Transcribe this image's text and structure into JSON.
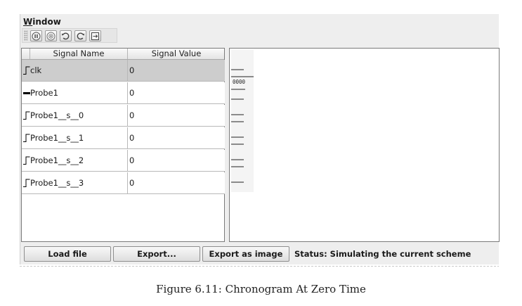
{
  "menu": {
    "window_mnemonic": "W",
    "window_rest": "indow"
  },
  "toolbar": {
    "buttons": [
      {
        "icon": "pause-icon"
      },
      {
        "icon": "stop-icon"
      },
      {
        "icon": "refresh-icon"
      },
      {
        "icon": "refresh-alt-icon"
      },
      {
        "icon": "fit-window-icon"
      }
    ]
  },
  "table": {
    "headers": {
      "name": "Signal Name",
      "value": "Signal Value"
    },
    "rows": [
      {
        "name": "clk",
        "value": "0",
        "kind": "bit",
        "selected": true
      },
      {
        "name": "Probe1",
        "value": "0",
        "kind": "bus",
        "selected": false
      },
      {
        "name": "Probe1__s__0",
        "value": "0",
        "kind": "bit",
        "selected": false
      },
      {
        "name": "Probe1__s__1",
        "value": "0",
        "kind": "bit",
        "selected": false
      },
      {
        "name": "Probe1__s__2",
        "value": "0",
        "kind": "bit",
        "selected": false
      },
      {
        "name": "Probe1__s__3",
        "value": "0",
        "kind": "bit",
        "selected": false
      }
    ]
  },
  "waveform": {
    "bus_value": "0000"
  },
  "statusbar": {
    "load_label": "Load file",
    "export_label": "Export...",
    "export_image_label": "Export as image",
    "status_text": "Status: Simulating the current scheme"
  },
  "caption": "Figure 6.11: Chronogram At Zero Time"
}
